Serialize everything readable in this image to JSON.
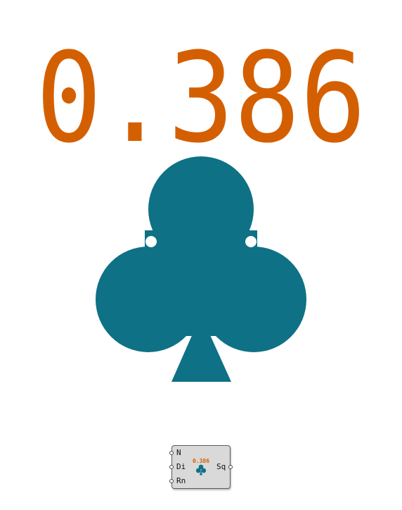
{
  "display": {
    "value": "0.386"
  },
  "symbol": {
    "icon": "club-icon",
    "color": "#0e7185"
  },
  "colors": {
    "value": "#d45f00",
    "club": "#0e7185"
  },
  "component": {
    "inputs": [
      "N",
      "Di",
      "Rn"
    ],
    "output": "Sq",
    "icon_value": "0.386",
    "icon": "club-icon"
  }
}
